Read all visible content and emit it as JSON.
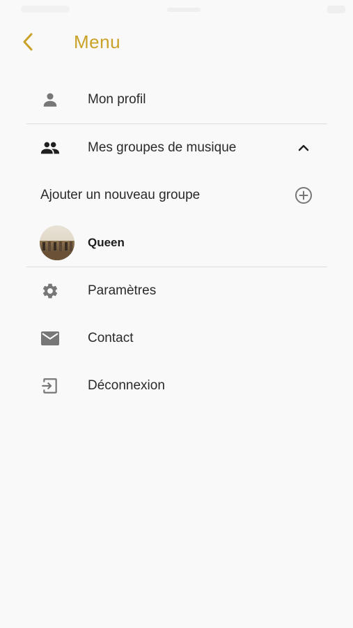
{
  "header": {
    "title": "Menu",
    "back_icon": "chevron-left-icon"
  },
  "colors": {
    "accent": "#c9a227",
    "background": "#f9f9f9",
    "divider": "#dcdcdc",
    "icon_gray": "#777777",
    "icon_dark": "#1f1f1f"
  },
  "menu": {
    "profile": {
      "label": "Mon profil",
      "icon": "person-icon"
    },
    "groups": {
      "label": "Mes groupes de musique",
      "icon": "people-icon",
      "toggle_icon": "chevron-up-icon"
    },
    "add_group": {
      "label": "Ajouter un nouveau groupe",
      "icon": "add-circle-icon"
    },
    "group_items": [
      {
        "label": "Queen"
      }
    ],
    "settings": {
      "label": "Paramètres",
      "icon": "gear-icon"
    },
    "contact": {
      "label": "Contact",
      "icon": "mail-icon"
    },
    "logout": {
      "label": "Déconnexion",
      "icon": "logout-icon"
    }
  }
}
